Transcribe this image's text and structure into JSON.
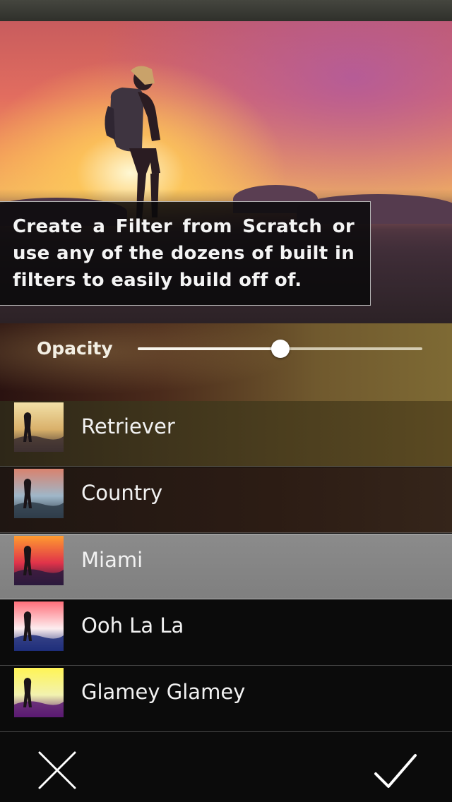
{
  "caption": {
    "text": "Create a Filter from Scratch or use any of the dozens of built in filters to easily build off of."
  },
  "opacity": {
    "label": "Opacity",
    "value": 0.5
  },
  "filters": [
    {
      "name": "Retriever",
      "thumb_colors": [
        "#f2e1a8",
        "#d9b06a",
        "#3d3030"
      ],
      "selected": false
    },
    {
      "name": "Country",
      "thumb_colors": [
        "#d9826e",
        "#9fb7c9",
        "#2f3d4a"
      ],
      "selected": false
    },
    {
      "name": "Miami",
      "thumb_colors": [
        "#ff9b2f",
        "#e0334a",
        "#2b1a3d"
      ],
      "selected": true
    },
    {
      "name": "Ooh La La",
      "thumb_colors": [
        "#ff6f7a",
        "#fdeef0",
        "#1e2e7a"
      ],
      "selected": false
    },
    {
      "name": "Glamey Glamey",
      "thumb_colors": [
        "#fff455",
        "#f2f2b0",
        "#5a1a72"
      ],
      "selected": false
    },
    {
      "name": "",
      "thumb_colors": [
        "#6fd07f",
        "#c9e8c0",
        "#20302a"
      ],
      "selected": false
    }
  ],
  "toolbar": {
    "cancel_icon": "close-icon",
    "confirm_icon": "checkmark-icon"
  },
  "colors": {
    "selected_row": "#858585",
    "background": "#0b0b0b",
    "caption_border": "#d2d2d2"
  }
}
